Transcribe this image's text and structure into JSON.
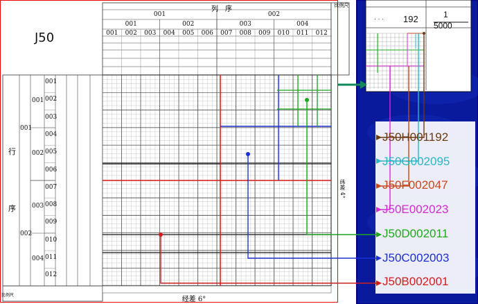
{
  "sheet": {
    "label": "J50"
  },
  "header": {
    "lie_xu": "列　序",
    "hang_xu_label": "比例尺",
    "level1": [
      "001",
      "002"
    ],
    "level2": [
      "001",
      "002",
      "003",
      "004"
    ],
    "level3": [
      "001",
      "002",
      "003",
      "004",
      "005",
      "006",
      "007",
      "008",
      "009",
      "010",
      "011",
      "012"
    ],
    "bottom_longitude": "经差 6°",
    "latitude_label": "纬差 4°",
    "row_title_1": "行",
    "row_title_2": "序",
    "scale_left": "比例尺"
  },
  "row_labels": {
    "level1": [
      "001",
      "002"
    ],
    "level2": [
      "001",
      "002",
      "003",
      "004"
    ],
    "level3": [
      "001",
      "002",
      "003",
      "004",
      "005",
      "006",
      "007",
      "008",
      "009",
      "010",
      "011",
      "012"
    ]
  },
  "inset": {
    "number": "192",
    "scale_top": "1",
    "scale_bottom": "5000",
    "dots": "· · ·"
  },
  "codes": [
    {
      "text": "J50H001192",
      "color": "#6b3a10"
    },
    {
      "text": "J50G002095",
      "color": "#29b6c6"
    },
    {
      "text": "J50F002047",
      "color": "#c8471a"
    },
    {
      "text": "J50E002023",
      "color": "#d42ad4"
    },
    {
      "text": "J50D002011",
      "color": "#1ea81e"
    },
    {
      "text": "J50C002003",
      "color": "#1c2fd6"
    },
    {
      "text": "J50B002001",
      "color": "#d21c1c"
    }
  ]
}
